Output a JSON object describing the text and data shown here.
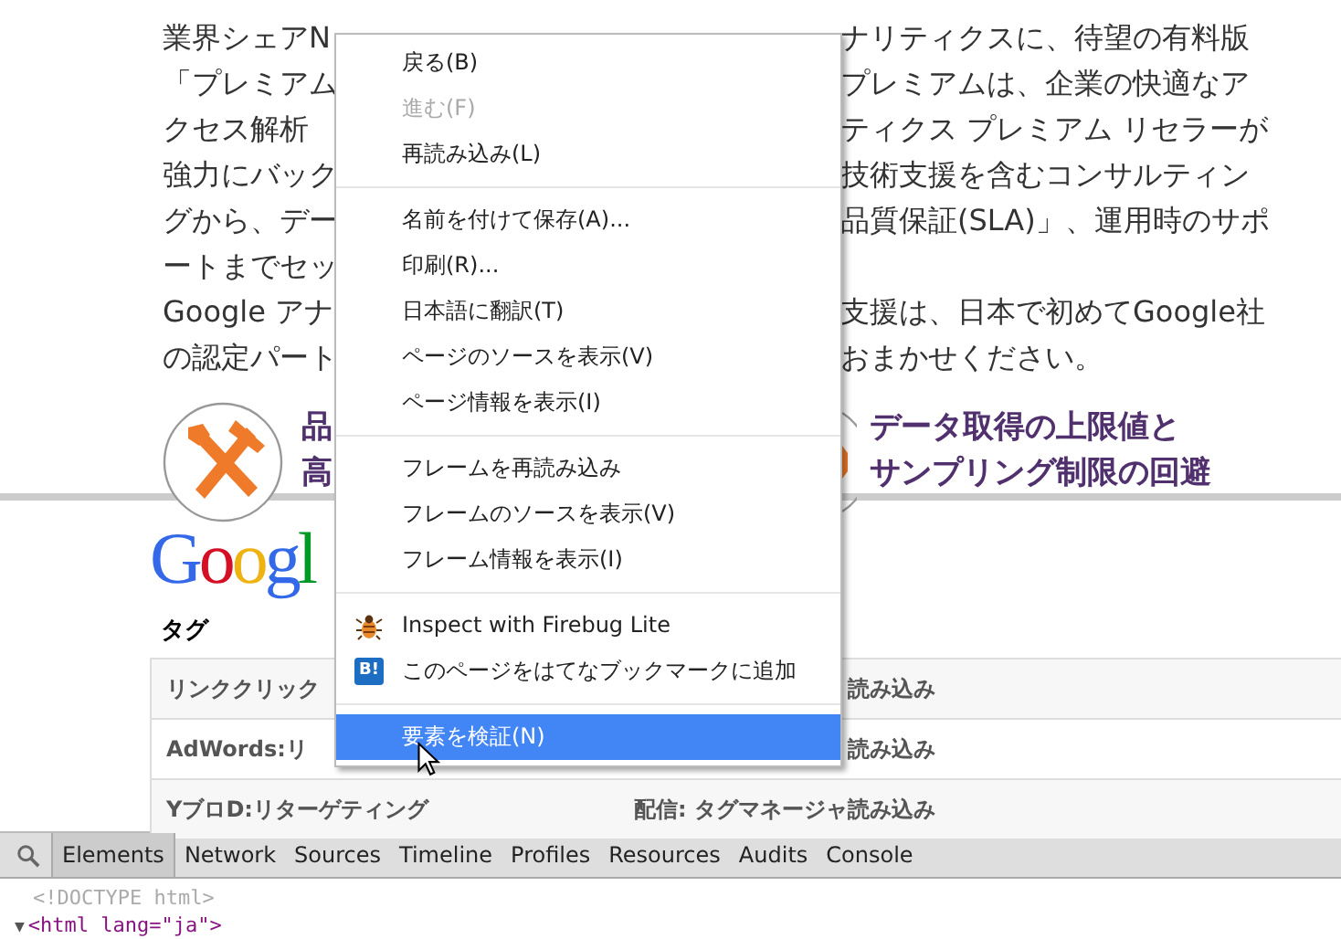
{
  "article": {
    "lines": [
      {
        "left": "業界シェアN",
        "right": "ナリティクスに、待望の有料版"
      },
      {
        "left": "「プレミアム",
        "right": "プレミアムは、企業の快適なア"
      },
      {
        "left": "クセス解析",
        "right": "ティクス プレミアム リセラーが"
      },
      {
        "left": "強力にバック",
        "right": "技術支援を含むコンサルティン"
      },
      {
        "left": "グから、デー",
        "right": "品質保証(SLA)」、運用時のサポ"
      },
      {
        "left": "ートまでセッ"
      },
      {
        "left": "Google アナ",
        "right": "支援は、日本で初めてGoogle社"
      },
      {
        "left": "の認定パート",
        "right": "おまかせください。"
      }
    ],
    "features": [
      {
        "lines": [
          "品",
          "高"
        ]
      },
      {
        "lines": [
          "データ取得の上限値と",
          "サンプリング制限の回避"
        ]
      }
    ]
  },
  "logo": [
    {
      "char": "G",
      "color": "#3369e8"
    },
    {
      "char": "o",
      "color": "#d50f25"
    },
    {
      "char": "o",
      "color": "#eeb211"
    },
    {
      "char": "g",
      "color": "#3369e8"
    },
    {
      "char": "l",
      "color": "#009925"
    }
  ],
  "tag_heading": "タグ",
  "table": {
    "rows": [
      {
        "cells": [
          "リンククリック",
          "読み込み"
        ]
      },
      {
        "cells": [
          "AdWords:リ",
          "読み込み"
        ]
      },
      {
        "cells": [
          "YブロD:リターゲティング",
          "配信: タグマネージャ読み込み"
        ]
      }
    ]
  },
  "context_menu": {
    "items": [
      {
        "kind": "item",
        "label": "戻る(B)",
        "disabled": false,
        "selected": false
      },
      {
        "kind": "item",
        "label": "進む(F)",
        "disabled": true,
        "selected": false
      },
      {
        "kind": "item",
        "label": "再読み込み(L)",
        "disabled": false,
        "selected": false
      },
      {
        "kind": "separator"
      },
      {
        "kind": "item",
        "label": "名前を付けて保存(A)...",
        "disabled": false,
        "selected": false
      },
      {
        "kind": "item",
        "label": "印刷(R)...",
        "disabled": false,
        "selected": false
      },
      {
        "kind": "item",
        "label": "日本語に翻訳(T)",
        "disabled": false,
        "selected": false
      },
      {
        "kind": "item",
        "label": "ページのソースを表示(V)",
        "disabled": false,
        "selected": false
      },
      {
        "kind": "item",
        "label": "ページ情報を表示(I)",
        "disabled": false,
        "selected": false
      },
      {
        "kind": "separator"
      },
      {
        "kind": "item",
        "label": "フレームを再読み込み",
        "disabled": false,
        "selected": false
      },
      {
        "kind": "item",
        "label": "フレームのソースを表示(V)",
        "disabled": false,
        "selected": false
      },
      {
        "kind": "item",
        "label": "フレーム情報を表示(I)",
        "disabled": false,
        "selected": false
      },
      {
        "kind": "separator"
      },
      {
        "kind": "bug_item",
        "label": "Inspect with Firebug Lite",
        "disabled": false,
        "selected": false
      },
      {
        "kind": "bookmark_item",
        "icon_text": "B!",
        "label": "このページをはてなブックマークに追加",
        "disabled": false,
        "selected": false
      },
      {
        "kind": "separator"
      },
      {
        "kind": "item",
        "label": "要素を検証(N)",
        "disabled": false,
        "selected": true
      }
    ]
  },
  "devtools": {
    "tabs": [
      {
        "label": "Elements",
        "selected": true
      },
      {
        "label": "Network",
        "selected": false
      },
      {
        "label": "Sources",
        "selected": false
      },
      {
        "label": "Timeline",
        "selected": false
      },
      {
        "label": "Profiles",
        "selected": false
      },
      {
        "label": "Resources",
        "selected": false
      },
      {
        "label": "Audits",
        "selected": false
      },
      {
        "label": "Console",
        "selected": false
      }
    ],
    "source": [
      {
        "kind": "doctype",
        "text": "<!DOCTYPE html>"
      },
      {
        "kind": "element",
        "arrow": "▼",
        "text": "<html lang=\"ja\">"
      }
    ]
  }
}
